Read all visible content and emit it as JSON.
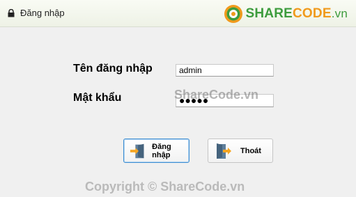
{
  "window": {
    "title": "Đăng nhập"
  },
  "brand": {
    "share": "SHARE",
    "code": "CODE",
    "vn": ".vn"
  },
  "form": {
    "username_label": "Tên đăng nhập",
    "username_value": "admin",
    "password_label": "Mật khẩu",
    "password_mask": "●●●●●"
  },
  "buttons": {
    "login": "Đăng nhập",
    "exit": "Thoát"
  },
  "watermarks": {
    "top": "ShareCode.vn",
    "bottom": "Copyright © ShareCode.vn"
  },
  "colors": {
    "brand_green": "#3d9c3d",
    "brand_orange": "#f09a1c",
    "focus_border": "#3e8dd1"
  }
}
